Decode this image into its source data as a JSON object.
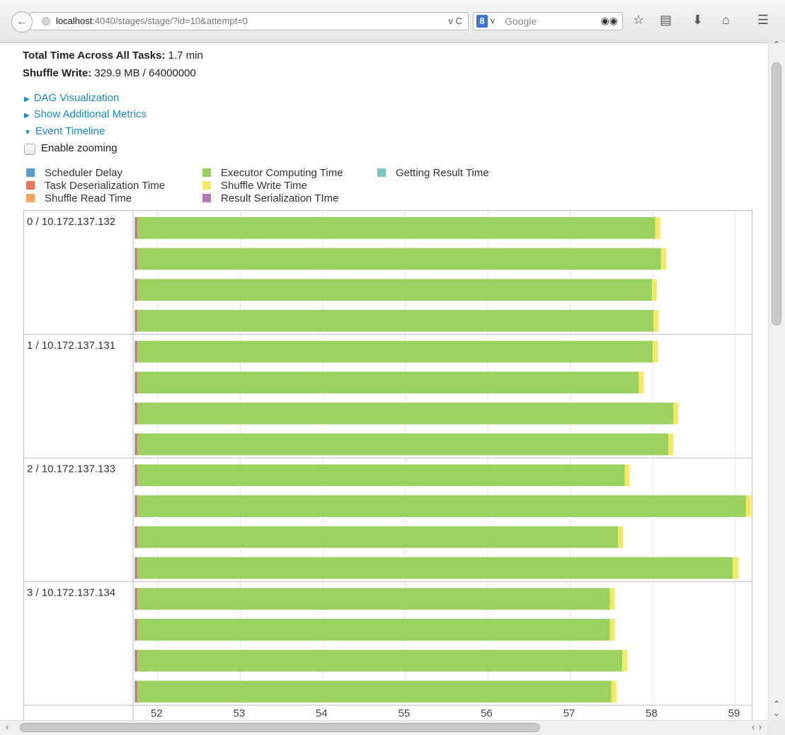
{
  "browser": {
    "url_host": "localhost",
    "url_rest": ":4040/stages/stage/?id=10&attempt=0",
    "url_controls": "v C",
    "search_engine_letter": "8",
    "search_dropdown": "v",
    "search_placeholder": "Google",
    "icons": [
      "back-arrow-icon",
      "globe-icon",
      "binoculars-icon",
      "star-icon",
      "clipboard-icon",
      "download-icon",
      "home-icon",
      "menu-icon"
    ]
  },
  "summary": {
    "total_time_label": "Total Time Across All Tasks:",
    "total_time_value": "1.7 min",
    "shuffle_write_label": "Shuffle Write:",
    "shuffle_write_value": "329.9 MB / 64000000"
  },
  "links": {
    "dag": "DAG Visualization",
    "metrics": "Show Additional Metrics",
    "timeline": "Event Timeline"
  },
  "zooming": {
    "label": "Enable zooming",
    "checked": false
  },
  "legend": [
    {
      "label": "Scheduler Delay",
      "color": "#5a9bd4"
    },
    {
      "label": "Task Deserialization Time",
      "color": "#f0735a"
    },
    {
      "label": "Shuffle Read Time",
      "color": "#f5a45a"
    },
    {
      "label": "Executor Computing Time",
      "color": "#9ad161"
    },
    {
      "label": "Shuffle Write Time",
      "color": "#f6e866"
    },
    {
      "label": "Result Serialization TIme",
      "color": "#b57ab5"
    },
    {
      "label": "Getting Result Time",
      "color": "#7cc7c0"
    }
  ],
  "chart_data": {
    "type": "timeline",
    "x_ticks": [
      52,
      53,
      54,
      55,
      56,
      57,
      58,
      59
    ],
    "x_range": [
      51.7,
      59.2
    ],
    "groups": [
      {
        "label": "0 / 10.172.137.132",
        "tasks": [
          {
            "start": 51.72,
            "compute_end": 58.03,
            "end": 58.09
          },
          {
            "start": 51.72,
            "compute_end": 58.1,
            "end": 58.16
          },
          {
            "start": 51.72,
            "compute_end": 57.99,
            "end": 58.05
          },
          {
            "start": 51.72,
            "compute_end": 58.01,
            "end": 58.07
          }
        ]
      },
      {
        "label": "1 / 10.172.137.131",
        "tasks": [
          {
            "start": 51.72,
            "compute_end": 58.0,
            "end": 58.06
          },
          {
            "start": 51.72,
            "compute_end": 57.83,
            "end": 57.89
          },
          {
            "start": 51.72,
            "compute_end": 58.25,
            "end": 58.31
          },
          {
            "start": 51.72,
            "compute_end": 58.19,
            "end": 58.25
          }
        ]
      },
      {
        "label": "2 / 10.172.137.133",
        "tasks": [
          {
            "start": 51.72,
            "compute_end": 57.66,
            "end": 57.72
          },
          {
            "start": 51.72,
            "compute_end": 59.13,
            "end": 59.19
          },
          {
            "start": 51.72,
            "compute_end": 57.58,
            "end": 57.64
          },
          {
            "start": 51.72,
            "compute_end": 58.97,
            "end": 59.04
          }
        ]
      },
      {
        "label": "3 / 10.172.137.134",
        "tasks": [
          {
            "start": 51.72,
            "compute_end": 57.48,
            "end": 57.54
          },
          {
            "start": 51.72,
            "compute_end": 57.48,
            "end": 57.54
          },
          {
            "start": 51.72,
            "compute_end": 57.63,
            "end": 57.69
          },
          {
            "start": 51.72,
            "compute_end": 57.5,
            "end": 57.56
          }
        ]
      }
    ]
  }
}
